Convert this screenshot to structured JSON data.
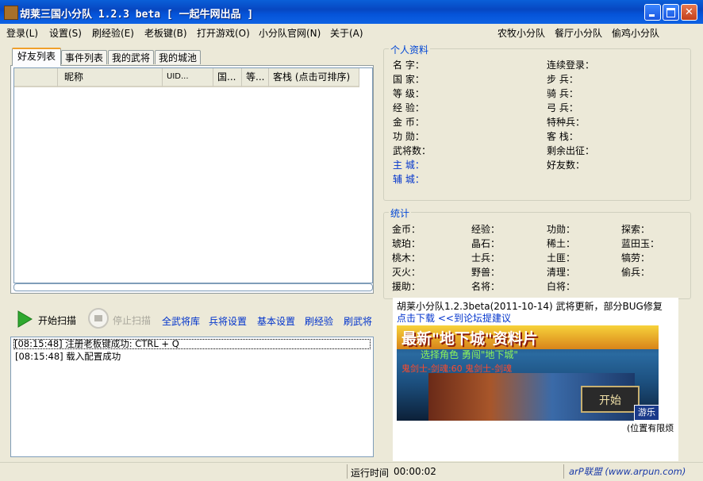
{
  "window": {
    "title": "胡莱三国小分队 1.2.3 beta [ 一起牛网出品 ]",
    "min_glyph": "",
    "max_glyph": "",
    "close_glyph": "✕"
  },
  "menu": {
    "items": [
      "登录(L)",
      "设置(S)",
      "刷经验(E)",
      "老板键(B)",
      "打开游戏(O)",
      "小分队官网(N)",
      "关于(A)"
    ],
    "right_items": [
      "农牧小分队",
      "餐厅小分队",
      "偷鸡小分队"
    ]
  },
  "tabs": [
    "好友列表",
    "事件列表",
    "我的武将",
    "我的城池"
  ],
  "list": {
    "columns": [
      "",
      "昵称",
      "UID...",
      "国...",
      "等...",
      "客栈 (点击可排序)"
    ]
  },
  "profile": {
    "title": "个人资料",
    "left": [
      "名  字：",
      "国  家：",
      "等  级：",
      "经  验：",
      "金  币：",
      "功  勋：",
      "武将数：",
      "主  城：",
      "辅  城："
    ],
    "right": [
      "连续登录：",
      "步  兵：",
      "骑  兵：",
      "弓  兵：",
      "特种兵：",
      "客  栈：",
      "剩余出征：",
      "好友数："
    ]
  },
  "stats": {
    "title": "统计",
    "col1": [
      "金币：",
      "琥珀：",
      "桃木：",
      "灭火：",
      "援助："
    ],
    "col2": [
      "经验：",
      "晶石：",
      "士兵：",
      "野兽：",
      "名将："
    ],
    "col3": [
      "功勋：",
      "稀土：",
      "土匪：",
      "清理：",
      "白将："
    ],
    "col4": [
      "探索：",
      "蓝田玉：",
      "犒劳：",
      "偷兵："
    ]
  },
  "toolbar": {
    "start": "开始扫描",
    "stop": "停止扫描",
    "links": [
      "全武将库",
      "兵将设置",
      "基本设置",
      "刷经验",
      "刷武将"
    ]
  },
  "log": [
    "[08:15:48] 注册老板键成功: CTRL + Q",
    "[08:15:48] 载入配置成功"
  ],
  "news": {
    "text": "胡莱小分队1.2.3beta(2011-10-14) 武将更新，部分BUG修复",
    "download_link": "点击下载",
    "forum_link": "<<到论坛提建议"
  },
  "banner": {
    "headline": "最新\"地下城\"资料片",
    "subline": "选择角色  勇闯\"地下城\"",
    "line3": "鬼剑士-剑魂:60  鬼剑士-剑魂",
    "start_btn": "开始",
    "tag": "游乐",
    "note": "(位置有限烦"
  },
  "status": {
    "runtime_label": "运行时间",
    "runtime_value": "00:00:02",
    "footer": "arP联盟 (www.arpun.com)"
  }
}
